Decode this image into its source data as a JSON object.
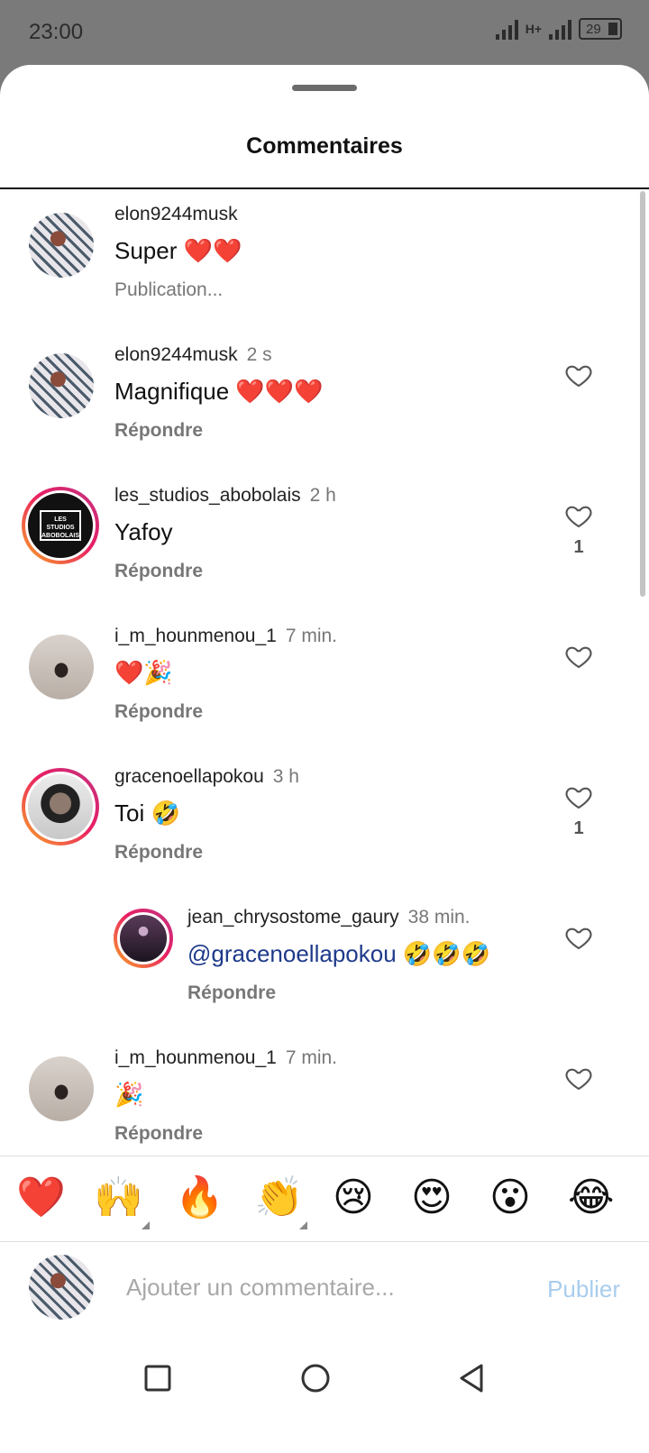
{
  "status": {
    "time": "23:00",
    "network": "H+",
    "battery": "29"
  },
  "sheet": {
    "title": "Commentaires"
  },
  "comments": [
    {
      "username": "elon9244musk",
      "time": "",
      "text": "Super ❤️❤️",
      "action": "Publication...",
      "likes": ""
    },
    {
      "username": "elon9244musk",
      "time": "2 s",
      "text": "Magnifique ❤️❤️❤️",
      "action": "Répondre",
      "likes": ""
    },
    {
      "username": "les_studios_abobolais",
      "time": "2 h",
      "text": "Yafoy",
      "action": "Répondre",
      "likes": "1"
    },
    {
      "username": "i_m_hounmenou_1",
      "time": "7 min.",
      "text": "❤️🎉",
      "action": "Répondre",
      "likes": ""
    },
    {
      "username": "gracenoellapokou",
      "time": "3 h",
      "text": "Toi 🤣",
      "action": "Répondre",
      "likes": "1"
    },
    {
      "username": "jean_chrysostome_gaury",
      "time": "38 min.",
      "mention": "@gracenoellapokou",
      "text": " 🤣🤣🤣",
      "action": "Répondre",
      "likes": ""
    },
    {
      "username": "i_m_hounmenou_1",
      "time": "7 min.",
      "text": "🎉",
      "action": "Répondre",
      "likes": ""
    }
  ],
  "studio_avatar_text": "LES STUDIOS ABOBOLAIS.",
  "reactions": [
    "❤️",
    "🙌",
    "🔥",
    "👏",
    "😢",
    "😍",
    "😮",
    "😂"
  ],
  "composer": {
    "placeholder": "Ajouter un commentaire...",
    "publish_label": "Publier"
  },
  "colors": {
    "accent_link": "#1e3a8a",
    "publish_disabled": "#a9cdee",
    "story_ring": "#e91e63"
  },
  "icons": {
    "like": "heart-icon",
    "nav_recent": "square-icon",
    "nav_home": "circle-icon",
    "nav_back": "triangle-icon"
  }
}
